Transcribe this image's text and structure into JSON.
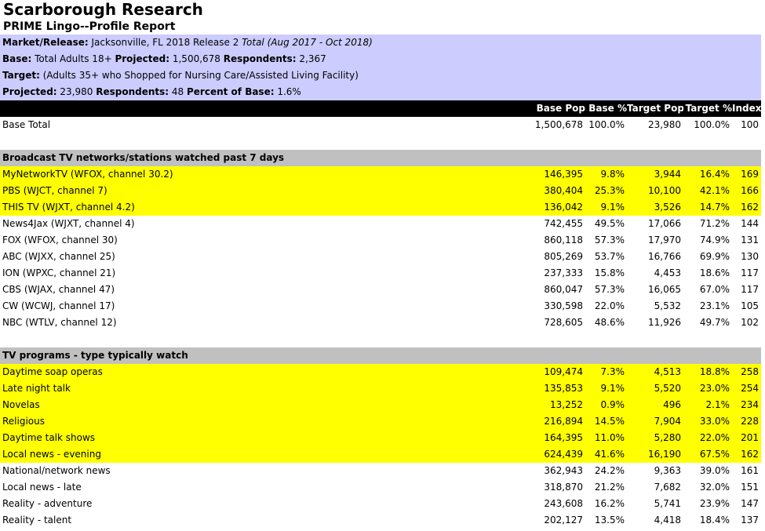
{
  "report": {
    "title": "Scarborough Research",
    "subtitle": "PRIME Lingo--Profile Report"
  },
  "info": {
    "market_label": "Market/Release:",
    "market_value": " Jacksonville, FL 2018 Release 2 ",
    "market_period": "Total (Aug 2017 - Oct 2018)",
    "base_label": "Base:",
    "base_value": " Total Adults 18+   ",
    "projected_label": "Projected:",
    "projected_value": " 1,500,678 ",
    "respondents_label": "Respondents:",
    "respondents_value": " 2,367",
    "target_label": "Target:",
    "target_value": " (Adults 35+ who Shopped for Nursing Care/Assisted Living Facility)",
    "t_projected_label": "Projected:",
    "t_projected_value": " 23,980 ",
    "t_respondents_label": "Respondents:",
    "t_respondents_value": " 48 ",
    "t_percent_label": "Percent of Base:",
    "t_percent_value": " 1.6%"
  },
  "columns": [
    "Base Pop",
    "Base %",
    "Target Pop",
    "Target %",
    "Index"
  ],
  "base_total": {
    "label": "Base Total",
    "base_pop": "1,500,678",
    "base_pct": "100.0%",
    "target_pop": "23,980",
    "target_pct": "100.0%",
    "index": "100"
  },
  "sections": [
    {
      "title": "Broadcast TV networks/stations watched past 7 days",
      "rows": [
        {
          "label": "MyNetworkTV (WFOX, channel 30.2)",
          "base_pop": "146,395",
          "base_pct": "9.8%",
          "target_pop": "3,944",
          "target_pct": "16.4%",
          "index": "169",
          "highlight": true
        },
        {
          "label": "PBS (WJCT, channel 7)",
          "base_pop": "380,404",
          "base_pct": "25.3%",
          "target_pop": "10,100",
          "target_pct": "42.1%",
          "index": "166",
          "highlight": true
        },
        {
          "label": "THIS TV (WJXT, channel 4.2)",
          "base_pop": "136,042",
          "base_pct": "9.1%",
          "target_pop": "3,526",
          "target_pct": "14.7%",
          "index": "162",
          "highlight": true
        },
        {
          "label": "News4Jax (WJXT, channel 4)",
          "base_pop": "742,455",
          "base_pct": "49.5%",
          "target_pop": "17,066",
          "target_pct": "71.2%",
          "index": "144",
          "highlight": false
        },
        {
          "label": "FOX (WFOX, channel 30)",
          "base_pop": "860,118",
          "base_pct": "57.3%",
          "target_pop": "17,970",
          "target_pct": "74.9%",
          "index": "131",
          "highlight": false
        },
        {
          "label": "ABC (WJXX, channel 25)",
          "base_pop": "805,269",
          "base_pct": "53.7%",
          "target_pop": "16,766",
          "target_pct": "69.9%",
          "index": "130",
          "highlight": false
        },
        {
          "label": "ION (WPXC, channel 21)",
          "base_pop": "237,333",
          "base_pct": "15.8%",
          "target_pop": "4,453",
          "target_pct": "18.6%",
          "index": "117",
          "highlight": false
        },
        {
          "label": "CBS (WJAX, channel 47)",
          "base_pop": "860,047",
          "base_pct": "57.3%",
          "target_pop": "16,065",
          "target_pct": "67.0%",
          "index": "117",
          "highlight": false
        },
        {
          "label": "CW (WCWJ, channel 17)",
          "base_pop": "330,598",
          "base_pct": "22.0%",
          "target_pop": "5,532",
          "target_pct": "23.1%",
          "index": "105",
          "highlight": false
        },
        {
          "label": "NBC (WTLV, channel 12)",
          "base_pop": "728,605",
          "base_pct": "48.6%",
          "target_pop": "11,926",
          "target_pct": "49.7%",
          "index": "102",
          "highlight": false
        }
      ]
    },
    {
      "title": "TV programs - type typically watch",
      "rows": [
        {
          "label": "Daytime soap operas",
          "base_pop": "109,474",
          "base_pct": "7.3%",
          "target_pop": "4,513",
          "target_pct": "18.8%",
          "index": "258",
          "highlight": true
        },
        {
          "label": "Late night talk",
          "base_pop": "135,853",
          "base_pct": "9.1%",
          "target_pop": "5,520",
          "target_pct": "23.0%",
          "index": "254",
          "highlight": true
        },
        {
          "label": "Novelas",
          "base_pop": "13,252",
          "base_pct": "0.9%",
          "target_pop": "496",
          "target_pct": "2.1%",
          "index": "234",
          "highlight": true
        },
        {
          "label": "Religious",
          "base_pop": "216,894",
          "base_pct": "14.5%",
          "target_pop": "7,904",
          "target_pct": "33.0%",
          "index": "228",
          "highlight": true
        },
        {
          "label": "Daytime talk shows",
          "base_pop": "164,395",
          "base_pct": "11.0%",
          "target_pop": "5,280",
          "target_pct": "22.0%",
          "index": "201",
          "highlight": true
        },
        {
          "label": "Local news - evening",
          "base_pop": "624,439",
          "base_pct": "41.6%",
          "target_pop": "16,190",
          "target_pct": "67.5%",
          "index": "162",
          "highlight": true
        },
        {
          "label": "National/network news",
          "base_pop": "362,943",
          "base_pct": "24.2%",
          "target_pop": "9,363",
          "target_pct": "39.0%",
          "index": "161",
          "highlight": false
        },
        {
          "label": "Local news - late",
          "base_pop": "318,870",
          "base_pct": "21.2%",
          "target_pop": "7,682",
          "target_pct": "32.0%",
          "index": "151",
          "highlight": false
        },
        {
          "label": "Reality - adventure",
          "base_pop": "243,608",
          "base_pct": "16.2%",
          "target_pop": "5,741",
          "target_pct": "23.9%",
          "index": "147",
          "highlight": false
        },
        {
          "label": "Reality - talent",
          "base_pop": "202,127",
          "base_pct": "13.5%",
          "target_pop": "4,418",
          "target_pct": "18.4%",
          "index": "137",
          "highlight": false
        }
      ]
    }
  ],
  "colors": {
    "info_bg": "#ccccff",
    "header_bg": "#000000",
    "section_bg": "#c0c0c0",
    "highlight": "#ffff00"
  }
}
